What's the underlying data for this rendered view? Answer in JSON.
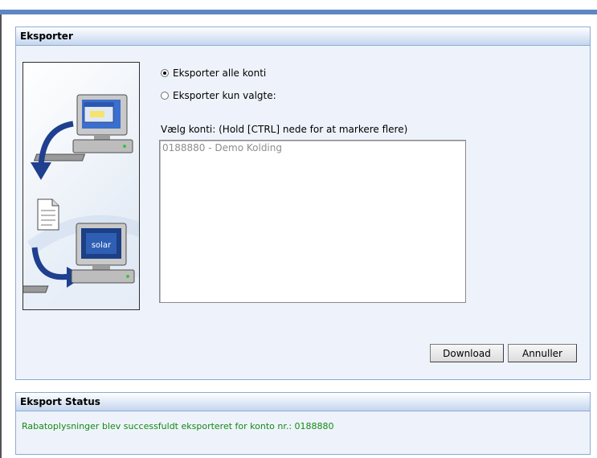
{
  "export_panel": {
    "title": "Eksporter",
    "radio_all": {
      "label": "Eksporter alle konti",
      "checked": true
    },
    "radio_selected": {
      "label": "Eksporter kun valgte:",
      "checked": false
    },
    "accounts_label": "Vælg konti: (Hold [CTRL] nede for at markere flere)",
    "accounts": [
      "0188880 - Demo Kolding"
    ],
    "illustration_brand": "solar",
    "download_label": "Download",
    "cancel_label": "Annuller"
  },
  "status_panel": {
    "title": "Eksport Status",
    "message": "Rabatoplysninger blev successfuldt eksporteret for konto nr.: 0188880",
    "message_color": "#138a13"
  },
  "colors": {
    "top_bar": "#5f86c2",
    "panel_border": "#8eaad2",
    "panel_bg": "#eef3fb",
    "arrow_blue": "#1f3f8f"
  }
}
